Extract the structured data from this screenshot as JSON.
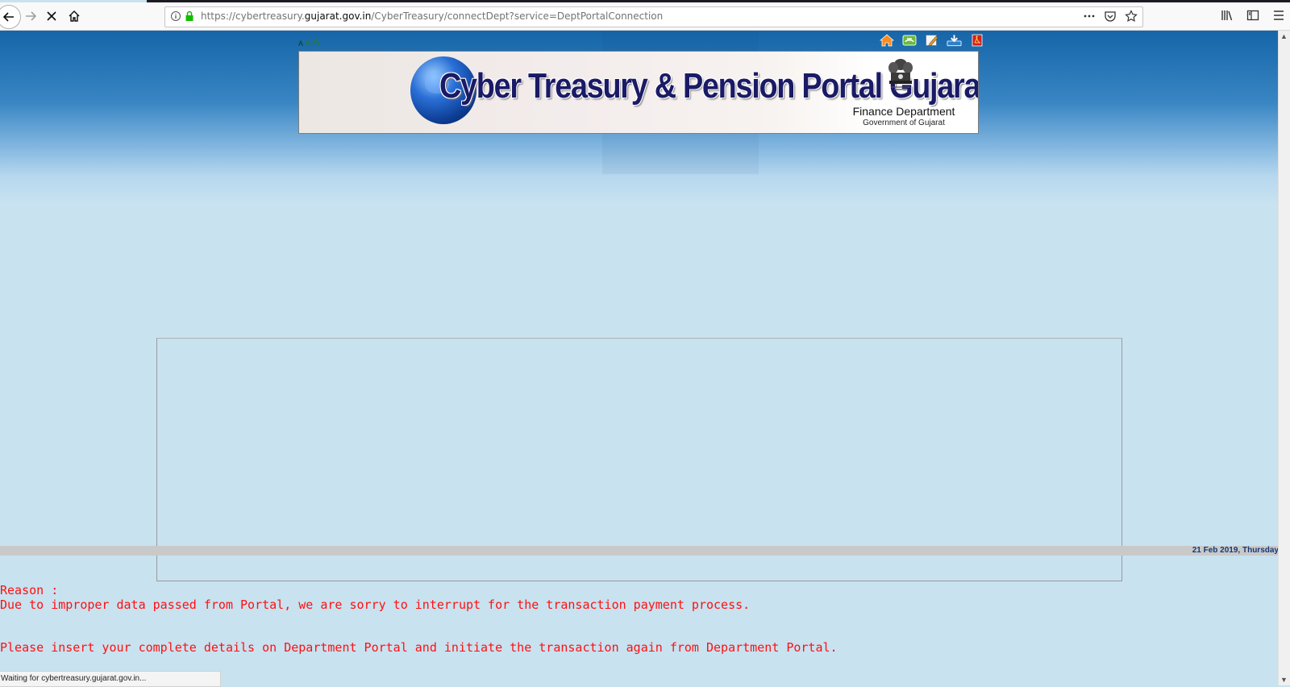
{
  "browser": {
    "url_prefix": "https://cybertreasury.",
    "url_domain": "gujarat.gov.in",
    "url_path": "/CyberTreasury/connectDept?service=DeptPortalConnection",
    "status_text": "Waiting for cybertreasury.gujarat.gov.in..."
  },
  "icons": [
    "back-arrow-icon",
    "forward-arrow-icon",
    "stop-loading-icon",
    "home-icon",
    "info-icon",
    "lock-icon",
    "more-icon",
    "pocket-icon",
    "bookmark-star-icon",
    "library-icon",
    "sidebar-icon",
    "menu-icon"
  ],
  "header": {
    "font_sizers": [
      "A",
      "A",
      "A"
    ],
    "icons": [
      "portal-home-icon",
      "contact-icon",
      "edit-icon",
      "download-icon",
      "pdf-icon"
    ]
  },
  "banner": {
    "title": "Cyber Treasury & Pension Portal Gujarat",
    "dept": "Finance Department",
    "gov": "Government of Gujarat"
  },
  "date": "21 Feb 2019, Thursday",
  "message": {
    "reason_label": "Reason :",
    "line1": "Due to improper data passed from Portal, we are sorry to interrupt for the transaction payment process.",
    "line2": "Please insert your complete details on Department Portal and initiate the transaction again from Department Portal."
  },
  "colors": {
    "error_text": "#ff1010",
    "page_bg": "#c8e2f0",
    "header_blue": "#1565a8",
    "date_text": "#123a78"
  }
}
